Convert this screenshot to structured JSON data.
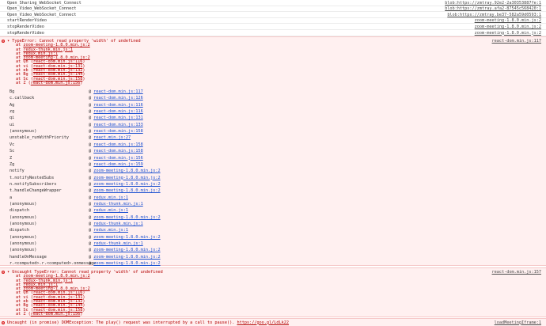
{
  "log_rows": [
    {
      "message": "Open_Sharing_WebSocket_Connect",
      "source": "blob:https://zmtray.92e2-2a30353887fe:1"
    },
    {
      "message": "Open_Video_WebSocket_Connect",
      "source": "blob:https://zmtray.afa2-87545c568420:1"
    },
    {
      "message": "Open_Video_WebSocket_Connect",
      "source": "blob:https://zmtray.be37-582a59d0593:1"
    },
    {
      "message": "startRenderVideo",
      "source": "zoom-meeting-1.8.0.min.js:2"
    },
    {
      "message": "stopRenderVideo",
      "source": "zoom-meeting-1.8.0.min.js:2"
    },
    {
      "message": "stopRenderVideo",
      "source": "zoom-meeting-1.8.0.min.js:2"
    }
  ],
  "error1": {
    "title": "▾ TypeError: Cannot read property 'width' of undefined",
    "source": "react-dom.min.js:117",
    "trace": [
      {
        "prefix": "at ",
        "loc": "zoom-meeting-1.8.0.min.js:2"
      },
      {
        "prefix": "at ",
        "loc": "redux-thunk.min.js:1"
      },
      {
        "prefix": "at ",
        "loc": "redux.min.js:1"
      },
      {
        "prefix": "at ",
        "loc": "zoom-meeting-1.8.0.min.js:2"
      },
      {
        "prefix": "at Qh (",
        "loc": "react-dom.min.js:116",
        "suffix": ")"
      },
      {
        "prefix": "at vi (",
        "loc": "react-dom.min.js:131",
        "suffix": ")"
      },
      {
        "prefix": "at eb (",
        "loc": "react-dom.min.js:132",
        "suffix": ")"
      },
      {
        "prefix": "at Bg (",
        "loc": "react-dom.min.js:144",
        "suffix": ")"
      },
      {
        "prefix": "at Sc (",
        "loc": "react-dom.min.js:158",
        "suffix": ")"
      },
      {
        "prefix": "at Z (",
        "loc": "react-dom.min.js:156",
        "suffix": ")"
      }
    ],
    "stack": [
      {
        "fn": "Bg",
        "loc": "react-dom.min.js:117"
      },
      {
        "fn": "c.callback",
        "loc": "react-dom.min.js:126"
      },
      {
        "fn": "Ag",
        "loc": "react-dom.min.js:116"
      },
      {
        "fn": "zg",
        "loc": "react-dom.min.js:116"
      },
      {
        "fn": "qi",
        "loc": "react-dom.min.js:131"
      },
      {
        "fn": "ui",
        "loc": "react-dom.min.js:133"
      },
      {
        "fn": "(anonymous)",
        "loc": "react-dom.min.js:158"
      },
      {
        "fn": "unstable_runWithPriority",
        "loc": "react.min.js:27"
      },
      {
        "fn": "Vc",
        "loc": "react-dom.min.js:158"
      },
      {
        "fn": "Sc",
        "loc": "react-dom.min.js:158"
      },
      {
        "fn": "Z",
        "loc": "react-dom.min.js:156"
      },
      {
        "fn": "Zg",
        "loc": "react-dom.min.js:159"
      },
      {
        "fn": "notify",
        "loc": "zoom-meeting-1.8.0.min.js:2"
      },
      {
        "fn": "t.notifyNestedSubs",
        "loc": "zoom-meeting-1.8.0.min.js:2"
      },
      {
        "fn": "n.notifySubscribers",
        "loc": "zoom-meeting-1.8.0.min.js:2"
      },
      {
        "fn": "t.handleChangeWrapper",
        "loc": "zoom-meeting-1.8.0.min.js:2"
      },
      {
        "fn": "a",
        "loc": "redux.min.js:1"
      },
      {
        "fn": "(anonymous)",
        "loc": "redux-thunk.min.js:1"
      },
      {
        "fn": "dispatch",
        "loc": "redux.min.js:1"
      },
      {
        "fn": "(anonymous)",
        "loc": "zoom-meeting-1.8.0.min.js:2"
      },
      {
        "fn": "(anonymous)",
        "loc": "redux-thunk.min.js:1"
      },
      {
        "fn": "dispatch",
        "loc": "redux.min.js:1"
      },
      {
        "fn": "(anonymous)",
        "loc": "zoom-meeting-1.8.0.min.js:2"
      },
      {
        "fn": "(anonymous)",
        "loc": "redux-thunk.min.js:1"
      },
      {
        "fn": "(anonymous)",
        "loc": "zoom-meeting-1.8.0.min.js:2"
      },
      {
        "fn": "handleOnMessage",
        "loc": "zoom-meeting-1.8.0.min.js:2"
      },
      {
        "fn": "r.<computed>.r.<computed>.onmessage",
        "loc": "zoom-meeting-1.8.0.min.js:2"
      }
    ]
  },
  "error2": {
    "title": "▾ Uncaught TypeError: Cannot read property 'width' of undefined",
    "source": "react-dom.min.js:157",
    "trace": [
      {
        "prefix": "at ",
        "loc": "zoom-meeting-1.8.0.min.js:2"
      },
      {
        "prefix": "at ",
        "loc": "redux-thunk.min.js:1"
      },
      {
        "prefix": "at ",
        "loc": "redux.min.js:1"
      },
      {
        "prefix": "at ",
        "loc": "zoom-meeting-1.8.0.min.js:2"
      },
      {
        "prefix": "at Qh (",
        "loc": "react-dom.min.js:116",
        "suffix": ")"
      },
      {
        "prefix": "at vi (",
        "loc": "react-dom.min.js:131",
        "suffix": ")"
      },
      {
        "prefix": "at eb (",
        "loc": "react-dom.min.js:132",
        "suffix": ")"
      },
      {
        "prefix": "at Bg (",
        "loc": "react-dom.min.js:144",
        "suffix": ")"
      },
      {
        "prefix": "at Sc (",
        "loc": "react-dom.min.js:158",
        "suffix": ")"
      },
      {
        "prefix": "at Z (",
        "loc": "react-dom.min.js:156",
        "suffix": ")"
      }
    ]
  },
  "unhandled": {
    "message": "Uncaught (in promise) DOMException: The play() request was interrupted by a call to pause(). ",
    "link": "https://goo.gl/LdLk22",
    "source": "loadMeetingIframe:1"
  }
}
